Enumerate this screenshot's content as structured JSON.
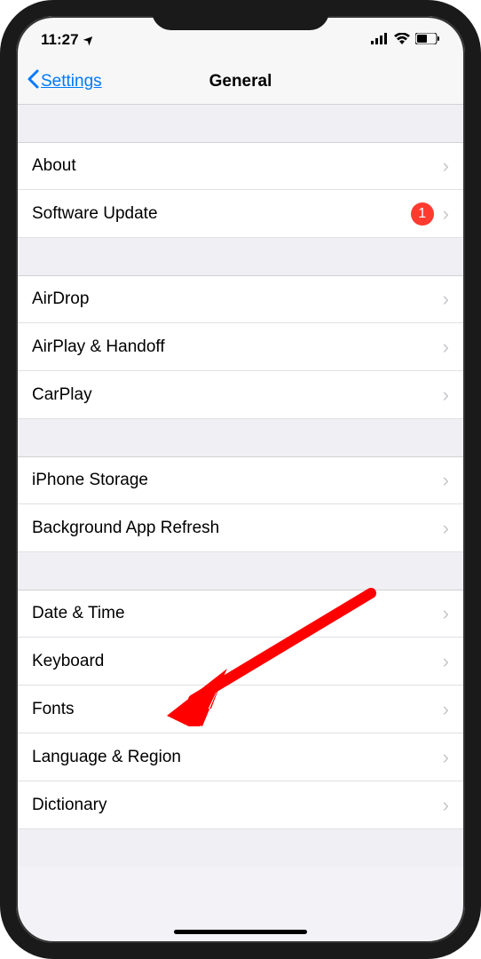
{
  "status_bar": {
    "time": "11:27",
    "location_icon": "➤"
  },
  "nav": {
    "back_label": "Settings",
    "title": "General"
  },
  "sections": [
    {
      "rows": [
        {
          "label": "About",
          "badge": null
        },
        {
          "label": "Software Update",
          "badge": "1"
        }
      ]
    },
    {
      "rows": [
        {
          "label": "AirDrop",
          "badge": null
        },
        {
          "label": "AirPlay & Handoff",
          "badge": null
        },
        {
          "label": "CarPlay",
          "badge": null
        }
      ]
    },
    {
      "rows": [
        {
          "label": "iPhone Storage",
          "badge": null
        },
        {
          "label": "Background App Refresh",
          "badge": null
        }
      ]
    },
    {
      "rows": [
        {
          "label": "Date & Time",
          "badge": null
        },
        {
          "label": "Keyboard",
          "badge": null
        },
        {
          "label": "Fonts",
          "badge": null
        },
        {
          "label": "Language & Region",
          "badge": null
        },
        {
          "label": "Dictionary",
          "badge": null
        }
      ]
    }
  ],
  "annotation": {
    "target": "Keyboard",
    "color": "#ff0000"
  }
}
